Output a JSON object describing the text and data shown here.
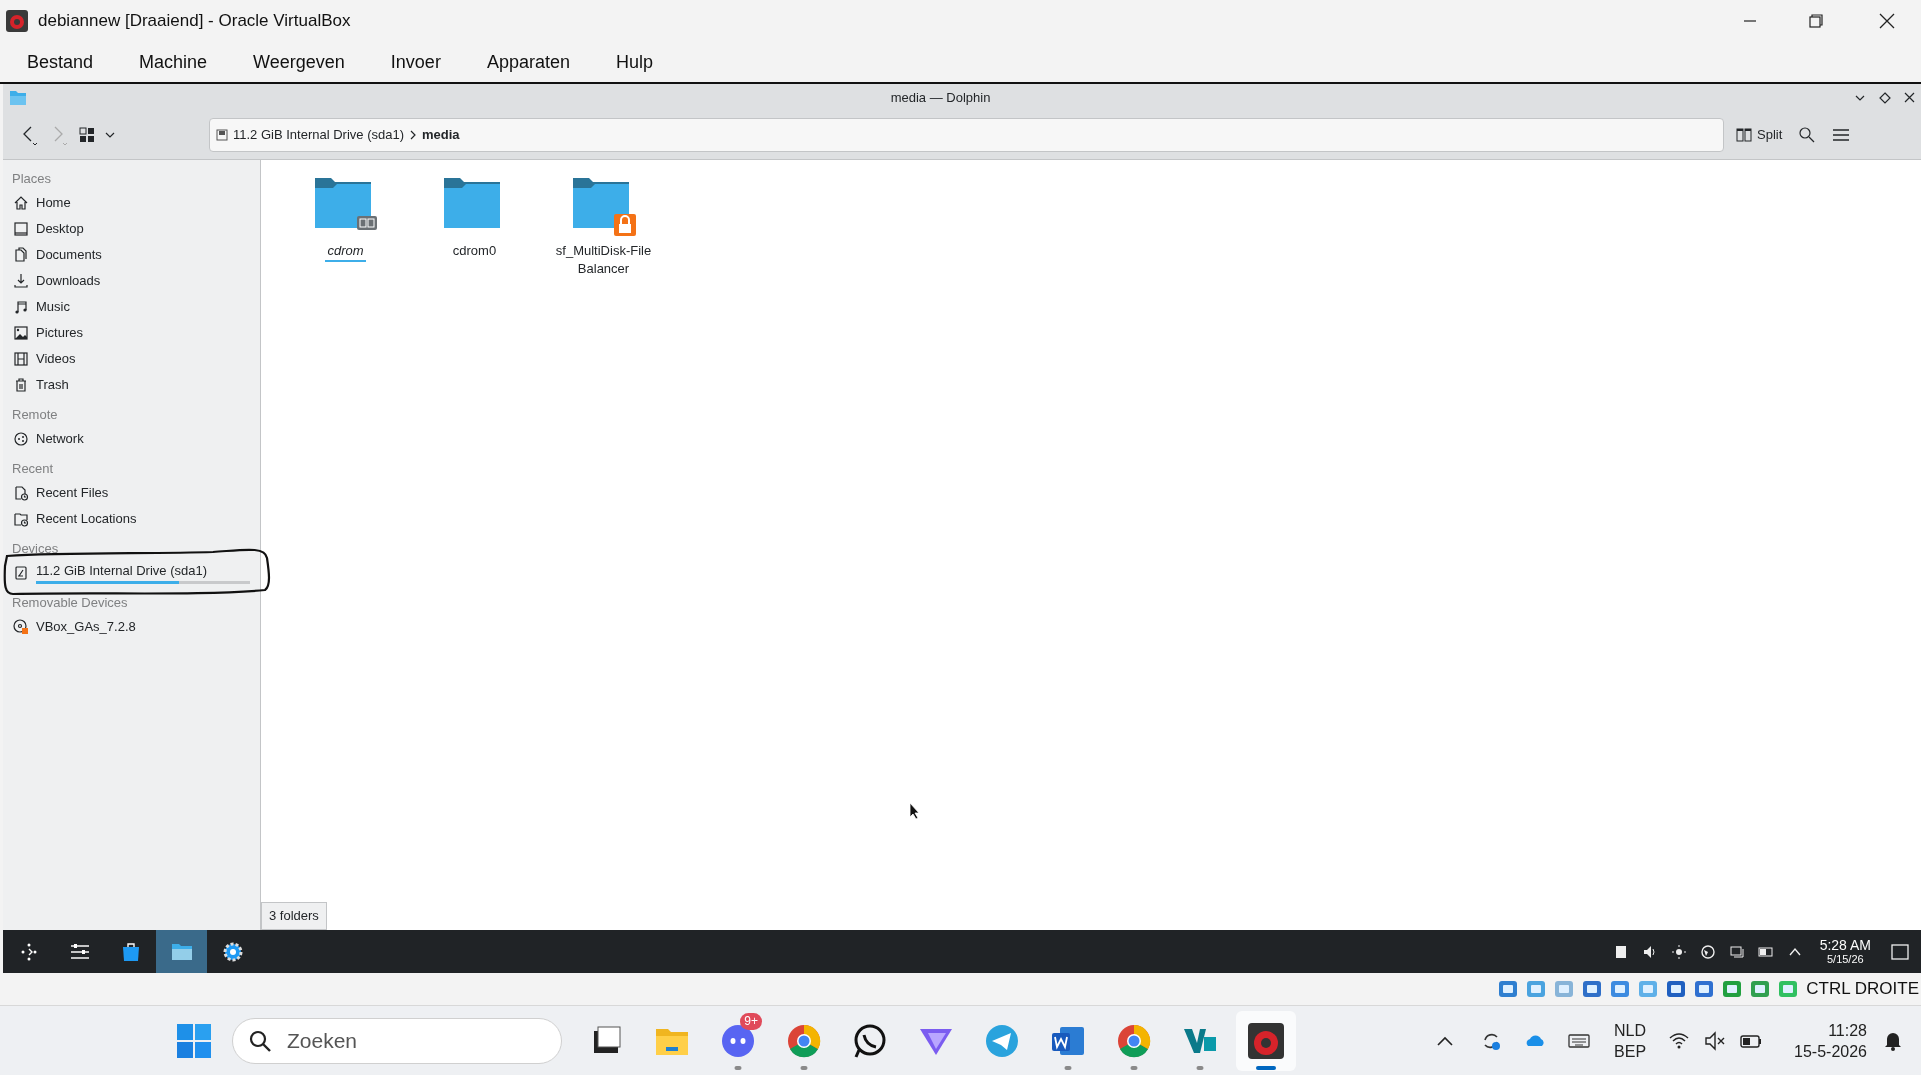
{
  "window": {
    "title": "debiannew [Draaiend] - Oracle VirtualBox"
  },
  "menu": [
    "Bestand",
    "Machine",
    "Weergeven",
    "Invoer",
    "Apparaten",
    "Hulp"
  ],
  "dolphin": {
    "title": "media — Dolphin",
    "breadcrumb": [
      {
        "label": "11.2 GiB Internal Drive (sda1)",
        "current": false
      },
      {
        "label": "media",
        "current": true
      }
    ],
    "split_label": "Split",
    "places": [
      {
        "heading": "Places",
        "items": [
          {
            "label": "Home",
            "kind": "home"
          },
          {
            "label": "Desktop",
            "kind": "desktop"
          },
          {
            "label": "Documents",
            "kind": "documents"
          },
          {
            "label": "Downloads",
            "kind": "downloads"
          },
          {
            "label": "Music",
            "kind": "music"
          },
          {
            "label": "Pictures",
            "kind": "pictures"
          },
          {
            "label": "Videos",
            "kind": "videos"
          },
          {
            "label": "Trash",
            "kind": "trash"
          }
        ]
      },
      {
        "heading": "Remote",
        "items": [
          {
            "label": "Network",
            "kind": "network"
          }
        ]
      },
      {
        "heading": "Recent",
        "items": [
          {
            "label": "Recent Files",
            "kind": "recent-files"
          },
          {
            "label": "Recent Locations",
            "kind": "recent-locations"
          }
        ]
      },
      {
        "heading": "Devices",
        "items": [
          {
            "label": "11.2 GiB Internal Drive (sda1)",
            "kind": "drive",
            "level": 0.67
          }
        ]
      },
      {
        "heading": "Removable Devices",
        "items": [
          {
            "label": "VBox_GAs_7.2.8",
            "kind": "disc"
          }
        ]
      }
    ],
    "files": [
      {
        "name": "cdrom",
        "kind": "link",
        "focused": true
      },
      {
        "name": "cdrom0",
        "kind": "plain",
        "focused": false
      },
      {
        "name": "sf_MultiDisk-File Balancer",
        "kind": "locked",
        "focused": false
      }
    ],
    "status": "3 folders"
  },
  "kde_panel": {
    "time": "5:28 AM",
    "date": "5/15/26"
  },
  "vbox_status": {
    "host_key": "CTRL DROITE"
  },
  "taskbar": {
    "search_placeholder": "Zoeken",
    "apps": [
      {
        "kind": "files-dark",
        "running": false,
        "active": false
      },
      {
        "kind": "explorer",
        "running": false,
        "active": false
      },
      {
        "kind": "chat",
        "running": true,
        "active": false,
        "badge": "9+"
      },
      {
        "kind": "browser",
        "running": true,
        "active": false
      },
      {
        "kind": "phone-chat",
        "running": false,
        "active": false
      },
      {
        "kind": "vpn",
        "running": false,
        "active": false
      },
      {
        "kind": "telegram",
        "running": false,
        "active": false
      },
      {
        "kind": "word",
        "running": true,
        "active": false
      },
      {
        "kind": "browser",
        "running": true,
        "active": false
      },
      {
        "kind": "vs",
        "running": true,
        "active": false
      },
      {
        "kind": "vbox",
        "running": true,
        "active": true
      }
    ],
    "language": "NLD",
    "layout": "BEP",
    "time": "11:28",
    "date": "15-5-2026"
  }
}
